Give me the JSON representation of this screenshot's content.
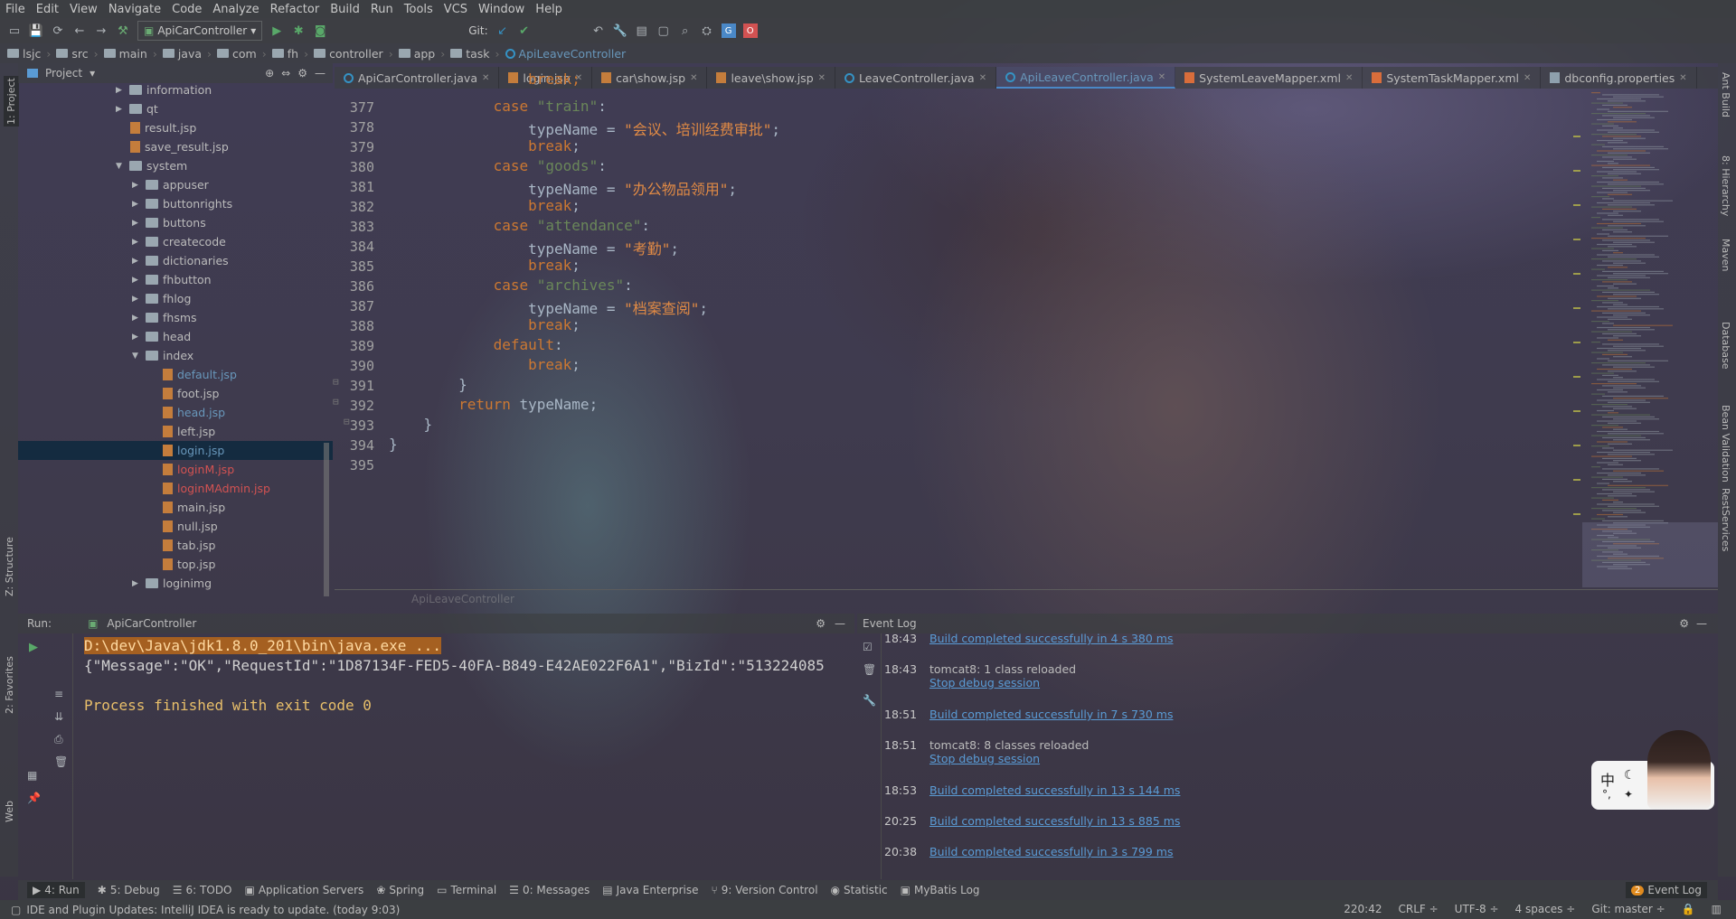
{
  "menu": [
    "File",
    "Edit",
    "View",
    "Navigate",
    "Code",
    "Analyze",
    "Refactor",
    "Build",
    "Run",
    "Tools",
    "VCS",
    "Window",
    "Help"
  ],
  "toolbar": {
    "run_config": "ApiCarController",
    "git_label": "Git:"
  },
  "breadcrumb": [
    "lsjc",
    "src",
    "main",
    "java",
    "com",
    "fh",
    "controller",
    "app",
    "task",
    "ApiLeaveController"
  ],
  "left_strip": {
    "project": "1: Project",
    "structure": "Z: Structure",
    "favorites": "2: Favorites",
    "web": "Web"
  },
  "project_panel": {
    "title": "Project"
  },
  "tree": [
    {
      "label": "information",
      "type": "folder",
      "indent": 1,
      "arrow": "▶"
    },
    {
      "label": "qt",
      "type": "folder",
      "indent": 1,
      "arrow": "▶"
    },
    {
      "label": "result.jsp",
      "type": "jsp",
      "indent": 1,
      "color": "#bbbbbb"
    },
    {
      "label": "save_result.jsp",
      "type": "jsp",
      "indent": 1,
      "color": "#bbbbbb"
    },
    {
      "label": "system",
      "type": "folder",
      "indent": 1,
      "arrow": "▼"
    },
    {
      "label": "appuser",
      "type": "folder",
      "indent": 2,
      "arrow": "▶"
    },
    {
      "label": "buttonrights",
      "type": "folder",
      "indent": 2,
      "arrow": "▶"
    },
    {
      "label": "buttons",
      "type": "folder",
      "indent": 2,
      "arrow": "▶"
    },
    {
      "label": "createcode",
      "type": "folder",
      "indent": 2,
      "arrow": "▶"
    },
    {
      "label": "dictionaries",
      "type": "folder",
      "indent": 2,
      "arrow": "▶"
    },
    {
      "label": "fhbutton",
      "type": "folder",
      "indent": 2,
      "arrow": "▶"
    },
    {
      "label": "fhlog",
      "type": "folder",
      "indent": 2,
      "arrow": "▶"
    },
    {
      "label": "fhsms",
      "type": "folder",
      "indent": 2,
      "arrow": "▶"
    },
    {
      "label": "head",
      "type": "folder",
      "indent": 2,
      "arrow": "▶"
    },
    {
      "label": "index",
      "type": "folder",
      "indent": 2,
      "arrow": "▼"
    },
    {
      "label": "default.jsp",
      "type": "jsp",
      "indent": 3,
      "color": "#6897bb"
    },
    {
      "label": "foot.jsp",
      "type": "jsp",
      "indent": 3,
      "color": "#bbbbbb"
    },
    {
      "label": "head.jsp",
      "type": "jsp",
      "indent": 3,
      "color": "#6897bb"
    },
    {
      "label": "left.jsp",
      "type": "jsp",
      "indent": 3,
      "color": "#bbbbbb"
    },
    {
      "label": "login.jsp",
      "type": "jsp",
      "indent": 3,
      "color": "#6897bb",
      "selected": true
    },
    {
      "label": "loginM.jsp",
      "type": "jsp",
      "indent": 3,
      "color": "#d25252"
    },
    {
      "label": "loginMAdmin.jsp",
      "type": "jsp",
      "indent": 3,
      "color": "#d25252"
    },
    {
      "label": "main.jsp",
      "type": "jsp",
      "indent": 3,
      "color": "#bbbbbb"
    },
    {
      "label": "null.jsp",
      "type": "jsp",
      "indent": 3,
      "color": "#bbbbbb"
    },
    {
      "label": "tab.jsp",
      "type": "jsp",
      "indent": 3,
      "color": "#bbbbbb"
    },
    {
      "label": "top.jsp",
      "type": "jsp",
      "indent": 3,
      "color": "#bbbbbb"
    },
    {
      "label": "loginimg",
      "type": "folder",
      "indent": 2,
      "arrow": "▶"
    }
  ],
  "tabs": [
    {
      "label": "ApiCarController.java",
      "icon": "class"
    },
    {
      "label": "login.jsp",
      "icon": "jsp"
    },
    {
      "label": "car\\show.jsp",
      "icon": "jsp"
    },
    {
      "label": "leave\\show.jsp",
      "icon": "jsp"
    },
    {
      "label": "LeaveController.java",
      "icon": "class"
    },
    {
      "label": "ApiLeaveController.java",
      "icon": "class",
      "active": true
    },
    {
      "label": "SystemLeaveMapper.xml",
      "icon": "xml"
    },
    {
      "label": "SystemTaskMapper.xml",
      "icon": "xml"
    },
    {
      "label": "dbconfig.properties",
      "icon": "props"
    }
  ],
  "code_lines": [
    {
      "n": "377",
      "t": [
        [
          "kw",
          "            case "
        ],
        [
          "str",
          "\"train\""
        ],
        [
          "",
          ":"
        ]
      ]
    },
    {
      "n": "378",
      "t": [
        [
          "",
          "                typeName = "
        ],
        [
          "strcn",
          "\"会议、培训经费审批\""
        ],
        [
          "",
          ";"
        ]
      ]
    },
    {
      "n": "379",
      "t": [
        [
          "kw",
          "                break"
        ],
        [
          "",
          ";"
        ]
      ]
    },
    {
      "n": "380",
      "t": [
        [
          "kw",
          "            case "
        ],
        [
          "str",
          "\"goods\""
        ],
        [
          "",
          ":"
        ]
      ]
    },
    {
      "n": "381",
      "t": [
        [
          "",
          "                typeName = "
        ],
        [
          "strcn",
          "\"办公物品领用\""
        ],
        [
          "",
          ";"
        ]
      ]
    },
    {
      "n": "382",
      "t": [
        [
          "kw",
          "                break"
        ],
        [
          "",
          ";"
        ]
      ]
    },
    {
      "n": "383",
      "t": [
        [
          "kw",
          "            case "
        ],
        [
          "str",
          "\"attendance\""
        ],
        [
          "",
          ":"
        ]
      ]
    },
    {
      "n": "384",
      "t": [
        [
          "",
          "                typeName = "
        ],
        [
          "strcn",
          "\"考勤\""
        ],
        [
          "",
          ";"
        ]
      ]
    },
    {
      "n": "385",
      "t": [
        [
          "kw",
          "                break"
        ],
        [
          "",
          ";"
        ]
      ]
    },
    {
      "n": "386",
      "t": [
        [
          "kw",
          "            case "
        ],
        [
          "str",
          "\"archives\""
        ],
        [
          "",
          ":"
        ]
      ]
    },
    {
      "n": "387",
      "t": [
        [
          "",
          "                typeName = "
        ],
        [
          "strcn",
          "\"档案查阅\""
        ],
        [
          "",
          ";"
        ]
      ]
    },
    {
      "n": "388",
      "t": [
        [
          "kw",
          "                break"
        ],
        [
          "",
          ";"
        ]
      ]
    },
    {
      "n": "389",
      "t": [
        [
          "kw",
          "            default"
        ],
        [
          "",
          ":"
        ]
      ]
    },
    {
      "n": "390",
      "t": [
        [
          "kw",
          "                break"
        ],
        [
          "",
          ";"
        ]
      ]
    },
    {
      "n": "391",
      "t": [
        [
          "",
          "        }"
        ]
      ]
    },
    {
      "n": "392",
      "t": [
        [
          "kw",
          "        return "
        ],
        [
          "",
          "typeName;"
        ]
      ]
    },
    {
      "n": "393",
      "t": [
        [
          "",
          "    }"
        ]
      ]
    },
    {
      "n": "394",
      "t": [
        [
          "",
          "}"
        ]
      ]
    },
    {
      "n": "395",
      "t": [
        [
          "",
          ""
        ]
      ]
    }
  ],
  "partial_top_line": "break;",
  "run": {
    "label": "Run:",
    "config": "ApiCarController",
    "lines": [
      {
        "text": "D:\\dev\\Java\\jdk1.8.0_201\\bin\\java.exe ...",
        "style": "cmd"
      },
      {
        "text": "{\"Message\":\"OK\",\"RequestId\":\"1D87134F-FED5-40FA-B849-E42AE022F6A1\",\"BizId\":\"513224085",
        "style": "out"
      },
      {
        "text": "",
        "style": "out"
      },
      {
        "text": "Process finished with exit code 0",
        "style": "done"
      }
    ]
  },
  "event_log": {
    "title": "Event Log",
    "entries": [
      {
        "time": "18:43",
        "text": "Build completed successfully in 4 s 380 ms",
        "link": true
      },
      {
        "time": "18:43",
        "text": "tomcat8: 1 class reloaded",
        "sub": "Stop debug session"
      },
      {
        "time": "18:51",
        "text": "Build completed successfully in 7 s 730 ms",
        "link": true
      },
      {
        "time": "18:51",
        "text": "tomcat8: 8 classes reloaded",
        "sub": "Stop debug session"
      },
      {
        "time": "18:53",
        "text": "Build completed successfully in 13 s 144 ms",
        "link": true
      },
      {
        "time": "20:25",
        "text": "Build completed successfully in 13 s 885 ms",
        "link": true
      },
      {
        "time": "20:38",
        "text": "Build completed successfully in 3 s 799 ms",
        "link": true
      }
    ]
  },
  "tool_windows": [
    {
      "label": "4: Run",
      "active": true
    },
    {
      "label": "5: Debug"
    },
    {
      "label": "6: TODO"
    },
    {
      "label": "Application Servers"
    },
    {
      "label": "Spring"
    },
    {
      "label": "Terminal"
    },
    {
      "label": "0: Messages"
    },
    {
      "label": "Java Enterprise"
    },
    {
      "label": "9: Version Control"
    },
    {
      "label": "Statistic"
    },
    {
      "label": "MyBatis Log"
    }
  ],
  "event_log_button": {
    "count": "2",
    "label": "Event Log"
  },
  "status": {
    "message": "IDE and Plugin Updates: IntelliJ IDEA is ready to update. (today 9:03)",
    "position": "220:42",
    "line_sep": "CRLF ÷",
    "encoding": "UTF-8 ÷",
    "indent": "4 spaces ÷",
    "git": "Git: master ÷"
  },
  "right_strip": [
    "Ant Build",
    "8: Hierarchy",
    "Maven",
    "Database",
    "Bean Validation",
    "RestServices"
  ],
  "editor_crumb": "ApiLeaveController",
  "ime": {
    "text": "中"
  }
}
